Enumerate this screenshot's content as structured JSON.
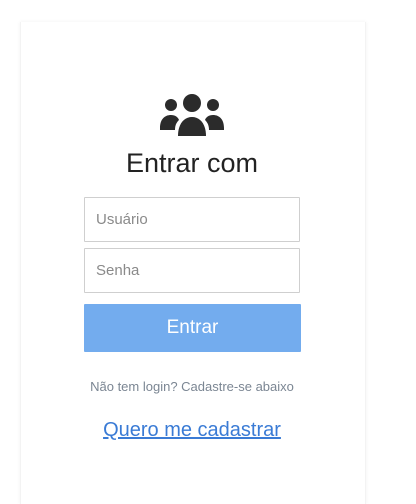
{
  "login": {
    "icon": "users-group-icon",
    "title": "Entrar com",
    "username_placeholder": "Usuário",
    "password_placeholder": "Senha",
    "submit_label": "Entrar",
    "hint": "Não tem login? Cadastre-se abaixo",
    "register_link": "Quero me cadastrar"
  },
  "colors": {
    "button": "#73acee",
    "link": "#3a7bd5",
    "title": "#222222"
  }
}
